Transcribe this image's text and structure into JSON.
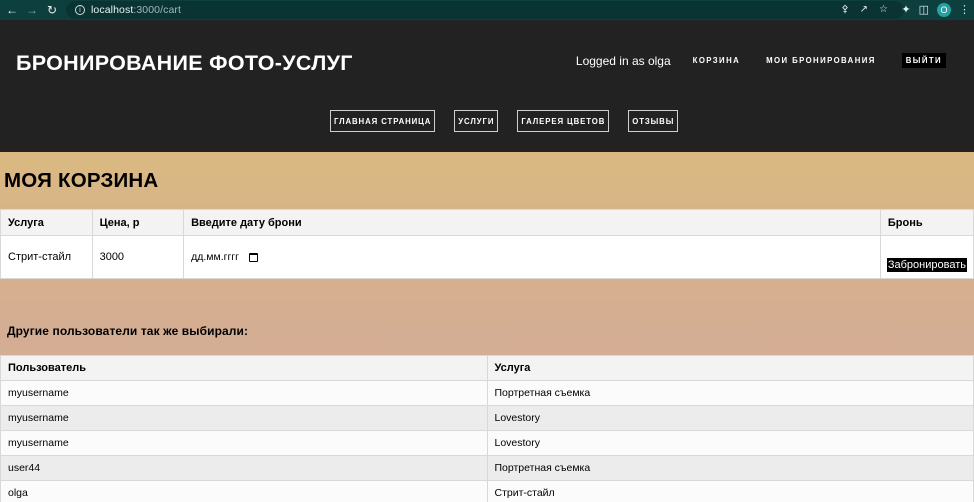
{
  "browser": {
    "url_host": "localhost",
    "url_path": ":3000/cart",
    "profile_initial": "O"
  },
  "header": {
    "site_title": "БРОНИРОВАНИЕ ФОТО-УСЛУГ",
    "logged_in_text": "Logged in as olga",
    "cart_link": "КОРЗИНА",
    "my_bookings_link": "МОИ БРОНИРОВАНИЯ",
    "logout_label": "ВЫЙТИ"
  },
  "nav": {
    "items": [
      {
        "label": "ГЛАВНАЯ СТРАНИЦА"
      },
      {
        "label": "УСЛУГИ"
      },
      {
        "label": "ГАЛЕРЕЯ ЦВЕТОВ"
      },
      {
        "label": "ОТЗЫВЫ"
      }
    ]
  },
  "cart": {
    "title": "МОЯ КОРЗИНА",
    "columns": {
      "service": "Услуга",
      "price": "Цена, р",
      "date": "Введите дату брони",
      "booking": "Бронь"
    },
    "row": {
      "service": "Стрит-стайл",
      "price": "3000",
      "date_placeholder": "дд.мм.гггг",
      "book_label": "Забронировать"
    }
  },
  "others": {
    "title": "Другие пользователи так же выбирали:",
    "columns": {
      "user": "Пользователь",
      "service": "Услуга"
    },
    "rows": [
      {
        "user": "myusername",
        "service": "Портретная съемка"
      },
      {
        "user": "myusername",
        "service": "Lovestory"
      },
      {
        "user": "myusername",
        "service": "Lovestory"
      },
      {
        "user": "user44",
        "service": "Портретная съемка"
      },
      {
        "user": "olga",
        "service": "Стрит-стайл"
      }
    ]
  },
  "colors": {
    "header_bg": "#222222",
    "chrome_bg": "#0e3f3f",
    "gradient_top": "#dab981",
    "gradient_bottom": "#d0aaa4"
  }
}
